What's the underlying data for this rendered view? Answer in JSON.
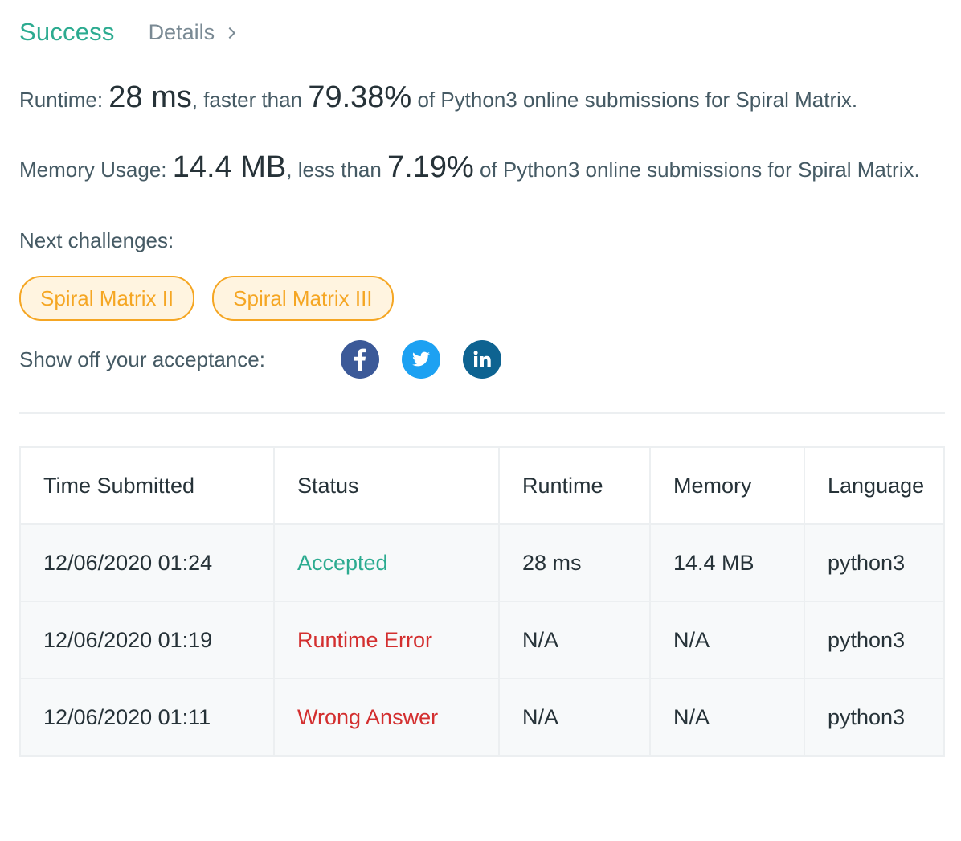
{
  "header": {
    "status": "Success",
    "details_label": "Details"
  },
  "runtime_stat": {
    "label": "Runtime:",
    "value": "28 ms",
    "middle": ", faster than",
    "percent": "79.38%",
    "suffix": "of Python3 online submissions for Spiral Matrix."
  },
  "memory_stat": {
    "label": "Memory Usage:",
    "value": "14.4 MB",
    "middle": ", less than",
    "percent": "7.19%",
    "suffix": "of Python3 online submissions for Spiral Matrix."
  },
  "next_challenges": {
    "label": "Next challenges:",
    "items": [
      "Spiral Matrix II",
      "Spiral Matrix III"
    ]
  },
  "share": {
    "label": "Show off your acceptance:",
    "icons": [
      "facebook-icon",
      "twitter-icon",
      "linkedin-icon"
    ]
  },
  "submissions": {
    "headers": [
      "Time Submitted",
      "Status",
      "Runtime",
      "Memory",
      "Language"
    ],
    "rows": [
      {
        "time": "12/06/2020 01:24",
        "status": "Accepted",
        "runtime": "28 ms",
        "memory": "14.4 MB",
        "language": "python3"
      },
      {
        "time": "12/06/2020 01:19",
        "status": "Runtime Error",
        "runtime": "N/A",
        "memory": "N/A",
        "language": "python3"
      },
      {
        "time": "12/06/2020 01:11",
        "status": "Wrong Answer",
        "runtime": "N/A",
        "memory": "N/A",
        "language": "python3"
      }
    ]
  },
  "colors": {
    "success": "#2cab90",
    "error": "#d32f2f",
    "chip": "#f5a623"
  }
}
